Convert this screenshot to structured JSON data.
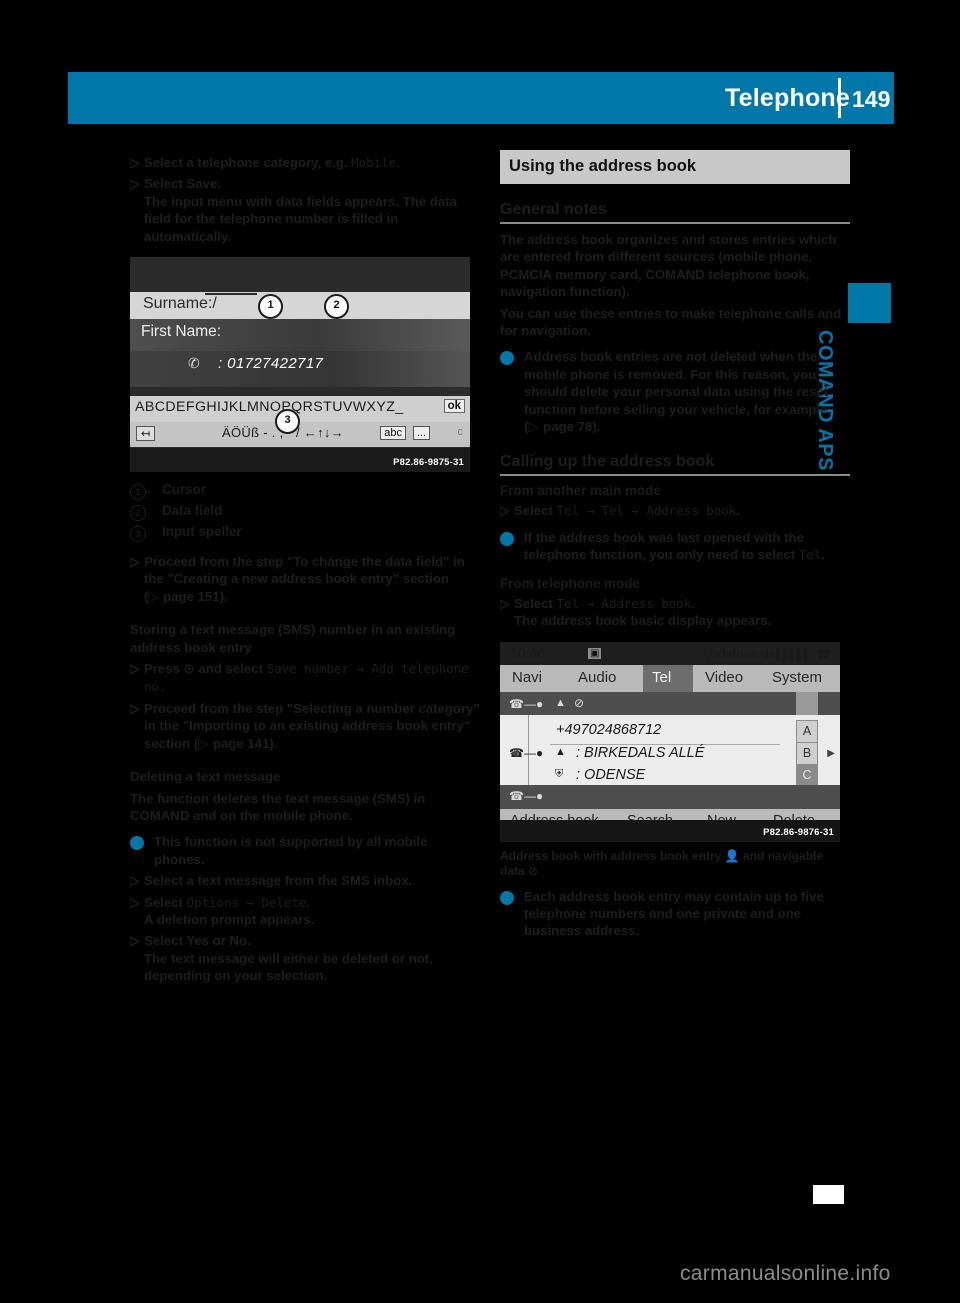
{
  "header": {
    "title": "Telephone",
    "page_number": "149",
    "accent_color": "#0077a8"
  },
  "side_tab": {
    "label": "COMAND APS"
  },
  "left_column": {
    "steps_top": [
      {
        "text": "Select a telephone category, e.g. ",
        "mono": "Mobile",
        "tail": "."
      },
      {
        "text": "Select Save.",
        "mono": "",
        "tail": ""
      }
    ],
    "step_result": "The input menu with data fields appears. The data field for the telephone number is filled in automatically.",
    "screenshot1": {
      "surname_label": "Surname:",
      "surname_value": "/",
      "firstname_label": "First Name:",
      "phone_value": ": 01727422717",
      "phone_icon": "phone-handset-icon",
      "keyboard_row1": "ABCDEFGHIJKLMNOPQRSTUVWXYZ_",
      "keyboard_ok": "ok",
      "keyboard_row2": "ÄÖÜß - . , · / ←↑↓→",
      "keyboard_abc": "abc",
      "keyboard_dots": "...",
      "keyboard_c": "c",
      "callout1": "1",
      "callout2": "2",
      "callout3": "3",
      "code": "P82.86-9875-31"
    },
    "legend": [
      {
        "num": "1",
        "label": "Cursor"
      },
      {
        "num": "2",
        "label": "Data field"
      },
      {
        "num": "3",
        "label": "Input speller"
      }
    ],
    "step_proceed": "Proceed from the step \"To change the data field\" in the \"Creating a new address book entry\" section (",
    "step_proceed_ref": "page 151).",
    "head_storing": "Storing a text message (SMS) number in an existing address book entry",
    "step_press_pre": "Press ",
    "step_press_icon": "⊙",
    "step_press_mid": " and select ",
    "step_press_mono1": "Save number",
    "step_press_arrow": " → ",
    "step_press_mono2": "Add telephone no.",
    "step_proceed2": "Proceed from the step \"Selecting a number category\" in the \"Importing to an existing address book entry\" section (",
    "step_proceed2_ref": "page 141).",
    "head_deleting": "Deleting a text message",
    "para_deleting": "The function deletes the text message (SMS) in COMAND and on the mobile phone.",
    "note_deleting": "This function is not supported by all mobile phones.",
    "step_select_sms": "Select a text message from the SMS inbox.",
    "step_options_pre": "Select ",
    "step_options_mono1": "Options",
    "step_options_arrow": " → ",
    "step_options_mono2": "Delete",
    "step_options_tail": ".",
    "step_options_result": "A deletion prompt appears.",
    "step_yesno": "Select Yes or No.",
    "step_yesno_result": "The text message will either be deleted or not, depending on your selection."
  },
  "right_column": {
    "band_title": "Using the address book",
    "head_general": "General notes",
    "para_general_1": "The address book organizes and stores entries which are entered from different sources (mobile phone, PCMCIA memory card, COMAND telephone book, navigation function).",
    "para_general_2": "You can use these entries to make telephone calls and for navigation.",
    "note_general": "Address book entries are not deleted when the mobile phone is removed. For this reason, you should delete your personal data using the reset function before selling your vehicle, for example (",
    "note_general_ref": "page 78).",
    "head_calling_up": "Calling up the address book",
    "head_from_main": "From another main mode",
    "step_main_pre": "Select ",
    "step_main_mono1": "Tel",
    "step_main_arrow1": " → ",
    "step_main_mono2": "Tel",
    "step_main_arrow2": " → ",
    "step_main_mono3": "Address book",
    "step_main_tail": ".",
    "note_last_opened_pre": "If the address book was last opened with the telephone function, you only need to select ",
    "note_last_opened_mono": "Tel",
    "note_last_opened_tail": ".",
    "head_from_tel": "From telephone mode",
    "step_tel_pre": "Select ",
    "step_tel_mono1": "Tel",
    "step_tel_arrow": " → ",
    "step_tel_mono2": "Address book",
    "step_tel_tail": ".",
    "step_tel_result": "The address book basic display appears.",
    "screenshot2": {
      "clock": "10:06",
      "sim_icon": "sim-card-icon",
      "carrier": "Vodafone.de",
      "signal_icon": "signal-bars-icon",
      "handset_icon": "handset-icon",
      "menu": [
        "Navi",
        "Audio",
        "Tel",
        "Video",
        "System"
      ],
      "selected_menu": "Tel",
      "entry_phone": "+497024868712",
      "entry_street": ": BIRKEDALS ALLÉ",
      "entry_city": ": ODENSE",
      "index_letters": [
        "A",
        "B",
        "C"
      ],
      "buttons": [
        "Address book",
        "Search",
        "New",
        "Delete"
      ],
      "code": "P82.86-9876-31"
    },
    "caption": "Address book with address book entry",
    "caption_icon1": "person-icon",
    "caption_mid": "and navigable data",
    "caption_icon2": "navigable-data-icon",
    "note_entries": "Each address book entry may contain up to five telephone numbers and one private and one business address."
  },
  "footer": {
    "watermark": "carmanualsonline.info"
  }
}
